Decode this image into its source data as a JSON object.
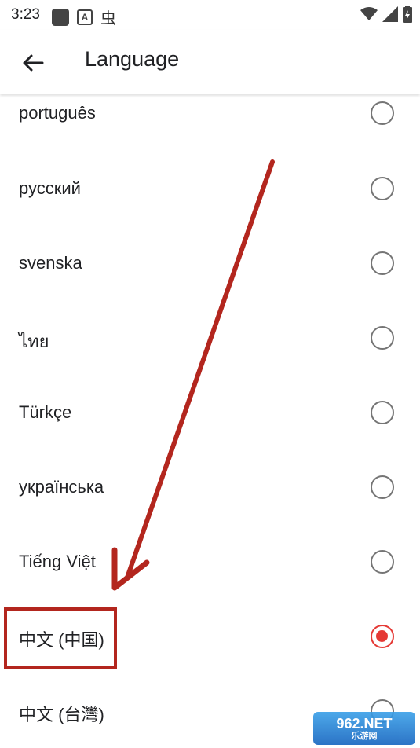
{
  "status_bar": {
    "time": "3:23",
    "a_glyph": "A"
  },
  "app_bar": {
    "title": "Language"
  },
  "languages": [
    {
      "label": "português",
      "selected": false
    },
    {
      "label": "русский",
      "selected": false
    },
    {
      "label": "svenska",
      "selected": false
    },
    {
      "label": "ไทย",
      "selected": false
    },
    {
      "label": "Türkçe",
      "selected": false
    },
    {
      "label": "українська",
      "selected": false
    },
    {
      "label": "Tiếng Việt",
      "selected": false
    },
    {
      "label": "中文 (中国)",
      "selected": true
    },
    {
      "label": "中文 (台灣)",
      "selected": false
    }
  ],
  "annotation": {
    "color": "#b3261e"
  },
  "accent_color": "#e53935",
  "watermark": {
    "top": "962.NET",
    "bottom": "乐游网"
  }
}
